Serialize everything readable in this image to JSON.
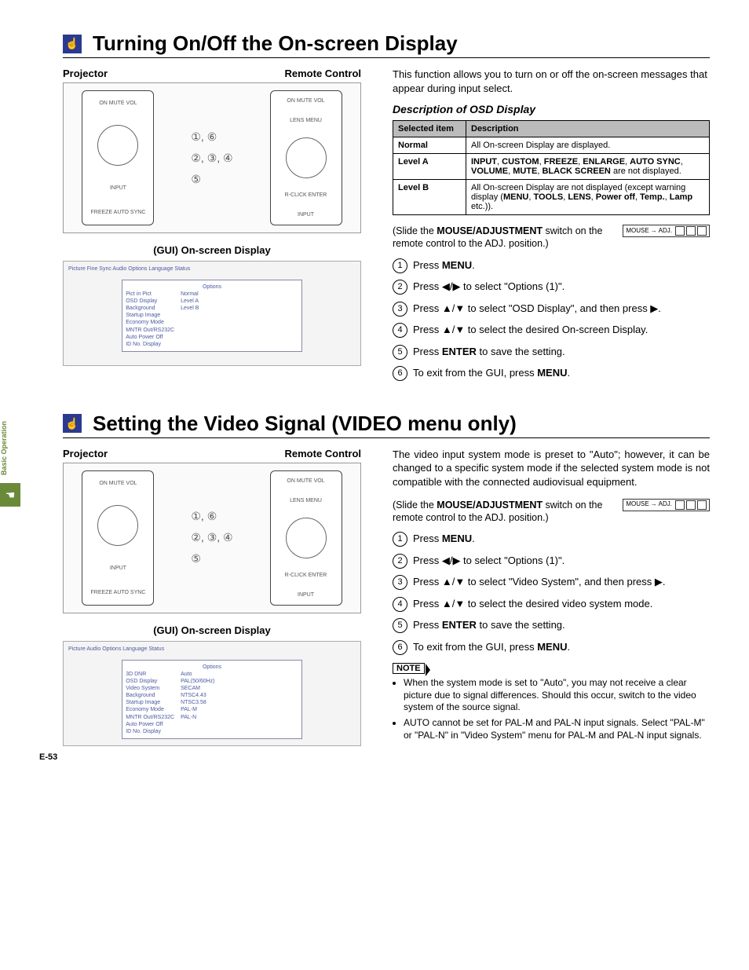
{
  "sideTab": {
    "label": "Basic Operation"
  },
  "section1": {
    "title": "Turning On/Off the On-screen Display",
    "diagramLeft": "Projector",
    "diagramRight": "Remote Control",
    "callout1": "①, ⑥",
    "callout2": "②, ③, ④",
    "callout3": "⑤",
    "guiLabel": "(GUI) On-screen Display",
    "intro": "This function allows you to turn on or off the on-screen messages that appear during input select.",
    "subhead": "Description of OSD Display",
    "table": {
      "h1": "Selected item",
      "h2": "Description",
      "rows": [
        {
          "c1": "Normal",
          "c2": "All On-screen Display are displayed."
        },
        {
          "c1": "Level A",
          "c2": "INPUT, CUSTOM, FREEZE, ENLARGE, AUTO SYNC, VOLUME, MUTE, BLACK SCREEN are not displayed.",
          "bold": true
        },
        {
          "c1": "Level B",
          "c2": "All On-screen Display are not displayed (except warning display (MENU, TOOLS, LENS, Power off, Temp., Lamp etc.))."
        }
      ]
    },
    "slideNote_a": "(Slide the ",
    "slideNote_b": "MOUSE/ADJUSTMENT",
    "slideNote_c": " switch on the remote control to the ADJ. position.)",
    "switchLabel1": "MOUSE",
    "switchLabel2": "ADJ.",
    "steps": [
      {
        "pre": "Press ",
        "b": "MENU",
        "post": "."
      },
      {
        "pre": "Press ◀/▶ to select \"Options (1)\"."
      },
      {
        "pre": "Press ▲/▼ to select \"OSD Display\", and then press ▶."
      },
      {
        "pre": "Press ▲/▼ to select the desired On-screen Display."
      },
      {
        "pre": "Press ",
        "b": "ENTER",
        "post": " to save the setting."
      },
      {
        "pre": "To exit from the GUI, press ",
        "b": "MENU",
        "post": "."
      }
    ]
  },
  "section2": {
    "title": "Setting the Video Signal (VIDEO menu only)",
    "diagramLeft": "Projector",
    "diagramRight": "Remote Control",
    "callout1": "①, ⑥",
    "callout2": "②, ③, ④",
    "callout3": "⑤",
    "guiLabel": "(GUI) On-screen Display",
    "intro": "The video input system mode is preset to \"Auto\"; however, it can be changed to a specific system mode if the selected system mode is not compatible with the connected audiovisual equipment.",
    "slideNote_a": "(Slide the ",
    "slideNote_b": "MOUSE/ADJUSTMENT",
    "slideNote_c": " switch on the remote control to the ADJ. position.)",
    "steps": [
      {
        "pre": "Press ",
        "b": "MENU",
        "post": "."
      },
      {
        "pre": "Press ◀/▶ to select \"Options (1)\"."
      },
      {
        "pre": "Press ▲/▼ to select \"Video System\", and then press ▶."
      },
      {
        "pre": "Press ▲/▼ to select the desired video system mode."
      },
      {
        "pre": "Press ",
        "b": "ENTER",
        "post": " to save the setting."
      },
      {
        "pre": "To exit from the GUI, press ",
        "b": "MENU",
        "post": "."
      }
    ],
    "noteLabel": "NOTE",
    "notes": [
      "When the system mode is set to \"Auto\", you may not receive a clear picture due to signal differences. Should this occur, switch to the video system of the source signal.",
      "AUTO cannot be set for PAL-M and PAL-N input signals. Select \"PAL-M\" or \"PAL-N\" in \"Video System\" menu for PAL-M and PAL-N input signals."
    ]
  },
  "pageNum": "E-53",
  "guiMenu1": {
    "tabs": "Picture  Fine Sync  Audio          Options  Language  Status",
    "header": "Options",
    "items": [
      "Pict in Pict",
      "OSD Display",
      "Background",
      "Startup Image",
      "Economy Mode",
      "MNTR Out/RS232C",
      "Auto Power Off",
      "ID No. Display"
    ],
    "side": [
      "Normal",
      "Level A",
      "Level B"
    ]
  },
  "guiMenu2": {
    "tabs": "Picture  Audio                Options  Language  Status",
    "header": "Options",
    "items": [
      "3D DNR",
      "OSD Display",
      "Video System",
      "Background",
      "Startup Image",
      "Economy Mode",
      "MNTR Out/RS232C",
      "Auto Power Off",
      "ID No. Display"
    ],
    "side": [
      "Auto",
      "PAL(50/60Hz)",
      "SECAM",
      "NTSC4.43",
      "NTSC3.58",
      "PAL-M",
      "PAL-N"
    ]
  }
}
